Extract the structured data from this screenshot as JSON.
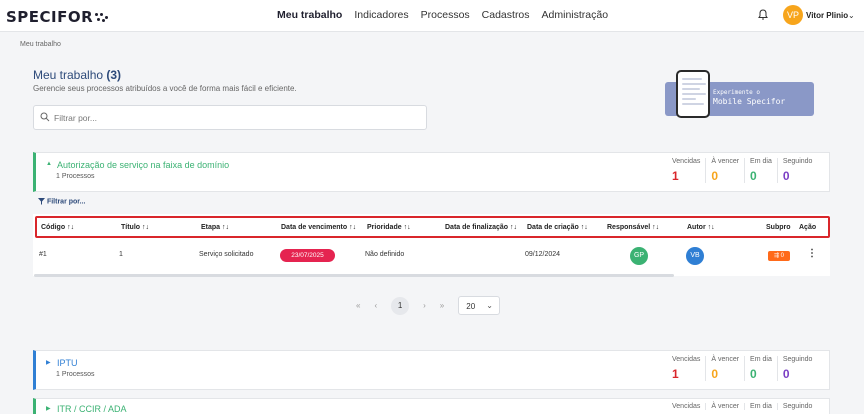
{
  "header": {
    "logo": "SPECIFOR",
    "nav": [
      "Meu trabalho",
      "Indicadores",
      "Processos",
      "Cadastros",
      "Administração"
    ],
    "avatar_initials": "VP",
    "user_name": "Vitor Plinio",
    "caret": "⌄"
  },
  "breadcrumb": "Meu trabalho",
  "page": {
    "title": "Meu trabalho",
    "count": "(3)",
    "subtitle": "Gerencie seus processos atribuídos a você de forma mais fácil e eficiente.",
    "filter_placeholder": "Filtrar por..."
  },
  "promo": {
    "line1": "Experimente o",
    "line2": "Mobile Specifor"
  },
  "stat_labels": [
    "Vencidas",
    "À vencer",
    "Em dia",
    "Seguindo"
  ],
  "stat_colors": [
    "#d9262b",
    "#f7a51c",
    "#3bb273",
    "#7b3fc4"
  ],
  "groups": [
    {
      "title": "Autorização de serviço na faixa de domínio",
      "count": "1 Processos",
      "arrow": "▲",
      "values": [
        "1",
        "0",
        "0",
        "0"
      ]
    },
    {
      "title": "IPTU",
      "count": "1 Processos",
      "arrow": "▶",
      "values": [
        "1",
        "0",
        "0",
        "0"
      ]
    },
    {
      "title": "ITR / CCIR / ADA",
      "arrow": "▶"
    }
  ],
  "table": {
    "filter_link": "Filtrar por...",
    "sort_icon": "↑↓",
    "headers": [
      "Código",
      "Título",
      "Etapa",
      "Data de vencimento",
      "Prioridade",
      "Data de finalização",
      "Data de criação",
      "Responsável",
      "Autor",
      "Subpro",
      "Ação"
    ],
    "row": {
      "codigo": "#1",
      "titulo": "1",
      "etapa": "Serviço solicitado",
      "vencimento": "23/07/2025",
      "prioridade": "Não definido",
      "criacao": "09/12/2024",
      "responsavel": "GP",
      "autor": "VB",
      "subpro": "0",
      "acao": "⋮"
    }
  },
  "pagination": {
    "first": "«",
    "prev": "‹",
    "current": "1",
    "next": "›",
    "last": "»",
    "page_size": "20",
    "size_caret": "⌄"
  }
}
